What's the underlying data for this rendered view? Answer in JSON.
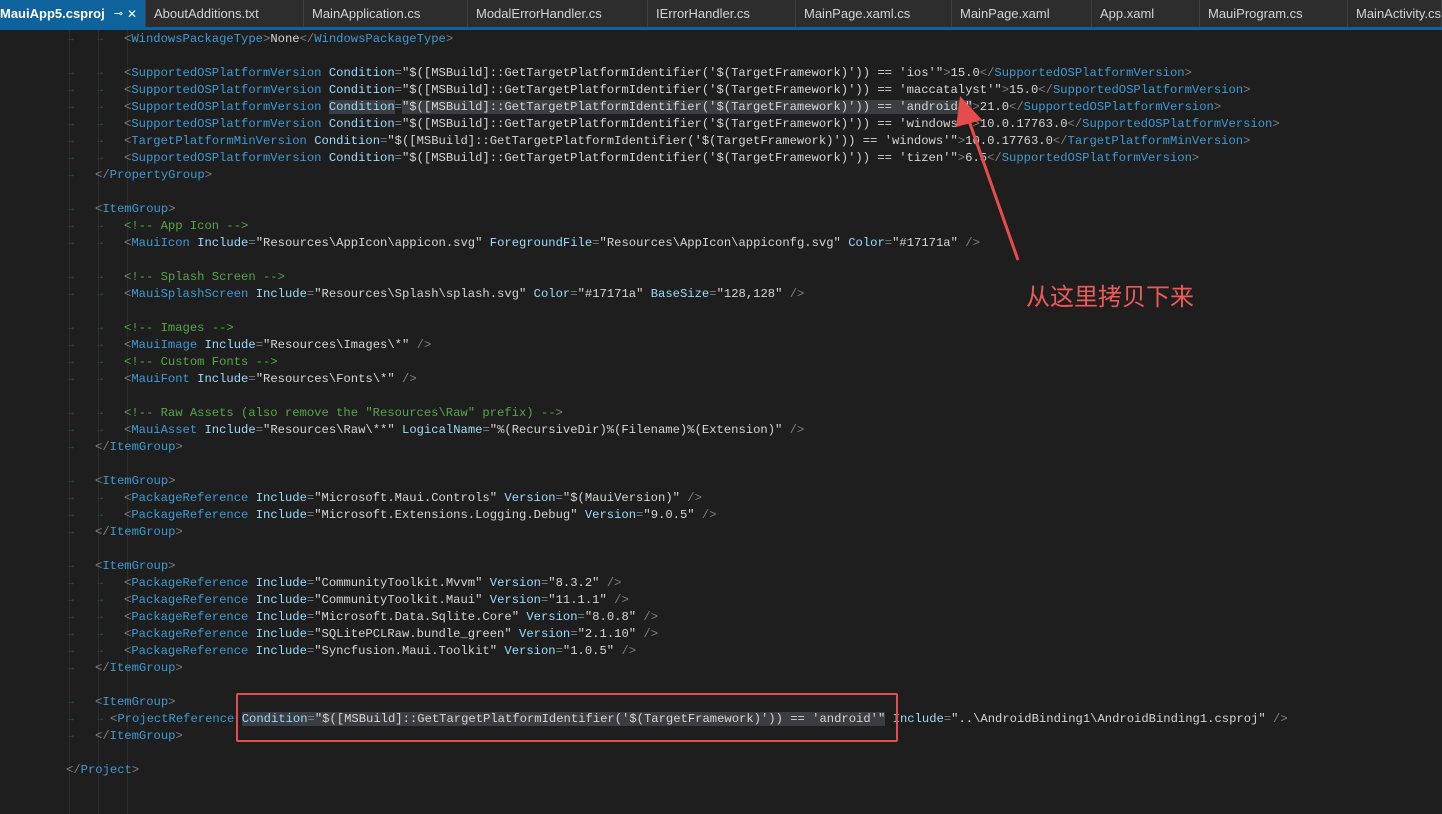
{
  "tabs": [
    {
      "label": "MauiApp5.csproj",
      "active": true,
      "pin_icon": "pin-icon",
      "close_icon": "close-icon"
    },
    {
      "label": "AboutAdditions.txt"
    },
    {
      "label": "MainApplication.cs"
    },
    {
      "label": "ModalErrorHandler.cs"
    },
    {
      "label": "IErrorHandler.cs"
    },
    {
      "label": "MainPage.xaml.cs"
    },
    {
      "label": "MainPage.xaml"
    },
    {
      "label": "App.xaml"
    },
    {
      "label": "MauiProgram.cs"
    },
    {
      "label": "MainActivity.cs"
    }
  ],
  "colors": {
    "tag": "#3f9bd4",
    "attribute": "#9cdcfe",
    "comment": "#57a64a",
    "annotation": "#ec5a5a",
    "tab_active": "#0e639c"
  },
  "annotation": {
    "text": "从这里拷贝下来",
    "arrow_icon": "red-arrow-icon"
  },
  "lines": [
    {
      "indent": 2,
      "tokens": [
        [
          "b",
          "<"
        ],
        [
          "t",
          "WindowsPackageType"
        ],
        [
          "b",
          ">"
        ],
        [
          "v",
          "None"
        ],
        [
          "b",
          "</"
        ],
        [
          "t",
          "WindowsPackageType"
        ],
        [
          "b",
          ">"
        ]
      ]
    },
    {
      "indent": 0,
      "tokens": []
    },
    {
      "indent": 2,
      "tokens": [
        [
          "b",
          "<"
        ],
        [
          "t",
          "SupportedOSPlatformVersion"
        ],
        [
          "p",
          " "
        ],
        [
          "a",
          "Condition"
        ],
        [
          "b",
          "="
        ],
        [
          "v",
          "\"$([MSBuild]::GetTargetPlatformIdentifier('$(TargetFramework)')) == 'ios'\""
        ],
        [
          "b",
          ">"
        ],
        [
          "v",
          "15.0"
        ],
        [
          "b",
          "</"
        ],
        [
          "t",
          "SupportedOSPlatformVersion"
        ],
        [
          "b",
          ">"
        ]
      ]
    },
    {
      "indent": 2,
      "tokens": [
        [
          "b",
          "<"
        ],
        [
          "t",
          "SupportedOSPlatformVersion"
        ],
        [
          "p",
          " "
        ],
        [
          "a",
          "Condition"
        ],
        [
          "b",
          "="
        ],
        [
          "v",
          "\"$([MSBuild]::GetTargetPlatformIdentifier('$(TargetFramework)')) == 'maccatalyst'\""
        ],
        [
          "b",
          ">"
        ],
        [
          "v",
          "15.0"
        ],
        [
          "b",
          "</"
        ],
        [
          "t",
          "SupportedOSPlatformVersion"
        ],
        [
          "b",
          ">"
        ]
      ]
    },
    {
      "indent": 2,
      "tokens": [
        [
          "b",
          "<"
        ],
        [
          "t",
          "SupportedOSPlatformVersion"
        ],
        [
          "p",
          " "
        ],
        [
          "ah",
          "Condition"
        ],
        [
          "b",
          "="
        ],
        [
          "vh",
          "\"$([MSBuild]::GetTargetPlatformIdentifier('$(TargetFramework)')) == 'android'\""
        ],
        [
          "b",
          ">"
        ],
        [
          "v",
          "21.0"
        ],
        [
          "b",
          "</"
        ],
        [
          "t",
          "SupportedOSPlatformVersion"
        ],
        [
          "b",
          ">"
        ]
      ]
    },
    {
      "indent": 2,
      "tokens": [
        [
          "b",
          "<"
        ],
        [
          "t",
          "SupportedOSPlatformVersion"
        ],
        [
          "p",
          " "
        ],
        [
          "a",
          "Condition"
        ],
        [
          "b",
          "="
        ],
        [
          "v",
          "\"$([MSBuild]::GetTargetPlatformIdentifier('$(TargetFramework)')) == 'windows'\""
        ],
        [
          "b",
          ">"
        ],
        [
          "v",
          "10.0.17763.0"
        ],
        [
          "b",
          "</"
        ],
        [
          "t",
          "SupportedOSPlatformVersion"
        ],
        [
          "b",
          ">"
        ]
      ]
    },
    {
      "indent": 2,
      "tokens": [
        [
          "b",
          "<"
        ],
        [
          "t",
          "TargetPlatformMinVersion"
        ],
        [
          "p",
          " "
        ],
        [
          "a",
          "Condition"
        ],
        [
          "b",
          "="
        ],
        [
          "v",
          "\"$([MSBuild]::GetTargetPlatformIdentifier('$(TargetFramework)')) == 'windows'\""
        ],
        [
          "b",
          ">"
        ],
        [
          "v",
          "10.0.17763.0"
        ],
        [
          "b",
          "</"
        ],
        [
          "t",
          "TargetPlatformMinVersion"
        ],
        [
          "b",
          ">"
        ]
      ]
    },
    {
      "indent": 2,
      "tokens": [
        [
          "b",
          "<"
        ],
        [
          "t",
          "SupportedOSPlatformVersion"
        ],
        [
          "p",
          " "
        ],
        [
          "a",
          "Condition"
        ],
        [
          "b",
          "="
        ],
        [
          "v",
          "\"$([MSBuild]::GetTargetPlatformIdentifier('$(TargetFramework)')) == 'tizen'\""
        ],
        [
          "b",
          ">"
        ],
        [
          "v",
          "6.5"
        ],
        [
          "b",
          "</"
        ],
        [
          "t",
          "SupportedOSPlatformVersion"
        ],
        [
          "b",
          ">"
        ]
      ]
    },
    {
      "indent": 1,
      "tokens": [
        [
          "b",
          "</"
        ],
        [
          "t",
          "PropertyGroup"
        ],
        [
          "b",
          ">"
        ]
      ]
    },
    {
      "indent": 0,
      "tokens": []
    },
    {
      "indent": 1,
      "tokens": [
        [
          "b",
          "<"
        ],
        [
          "t",
          "ItemGroup"
        ],
        [
          "b",
          ">"
        ]
      ]
    },
    {
      "indent": 2,
      "tokens": [
        [
          "c",
          "<!-- App Icon -->"
        ]
      ]
    },
    {
      "indent": 2,
      "tokens": [
        [
          "b",
          "<"
        ],
        [
          "t",
          "MauiIcon"
        ],
        [
          "p",
          " "
        ],
        [
          "a",
          "Include"
        ],
        [
          "b",
          "="
        ],
        [
          "v",
          "\"Resources\\AppIcon\\appicon.svg\""
        ],
        [
          "p",
          " "
        ],
        [
          "a",
          "ForegroundFile"
        ],
        [
          "b",
          "="
        ],
        [
          "v",
          "\"Resources\\AppIcon\\appiconfg.svg\""
        ],
        [
          "p",
          " "
        ],
        [
          "a",
          "Color"
        ],
        [
          "b",
          "="
        ],
        [
          "v",
          "\"#17171a\""
        ],
        [
          "p",
          " "
        ],
        [
          "b",
          "/>"
        ]
      ]
    },
    {
      "indent": 0,
      "tokens": []
    },
    {
      "indent": 2,
      "tokens": [
        [
          "c",
          "<!-- Splash Screen -->"
        ]
      ]
    },
    {
      "indent": 2,
      "tokens": [
        [
          "b",
          "<"
        ],
        [
          "t",
          "MauiSplashScreen"
        ],
        [
          "p",
          " "
        ],
        [
          "a",
          "Include"
        ],
        [
          "b",
          "="
        ],
        [
          "v",
          "\"Resources\\Splash\\splash.svg\""
        ],
        [
          "p",
          " "
        ],
        [
          "a",
          "Color"
        ],
        [
          "b",
          "="
        ],
        [
          "v",
          "\"#17171a\""
        ],
        [
          "p",
          " "
        ],
        [
          "a",
          "BaseSize"
        ],
        [
          "b",
          "="
        ],
        [
          "v",
          "\"128,128\""
        ],
        [
          "p",
          " "
        ],
        [
          "b",
          "/>"
        ]
      ]
    },
    {
      "indent": 0,
      "tokens": []
    },
    {
      "indent": 2,
      "tokens": [
        [
          "c",
          "<!-- Images -->"
        ]
      ]
    },
    {
      "indent": 2,
      "tokens": [
        [
          "b",
          "<"
        ],
        [
          "t",
          "MauiImage"
        ],
        [
          "p",
          " "
        ],
        [
          "a",
          "Include"
        ],
        [
          "b",
          "="
        ],
        [
          "v",
          "\"Resources\\Images\\*\""
        ],
        [
          "p",
          " "
        ],
        [
          "b",
          "/>"
        ]
      ]
    },
    {
      "indent": 2,
      "tokens": [
        [
          "c",
          "<!-- Custom Fonts -->"
        ]
      ]
    },
    {
      "indent": 2,
      "tokens": [
        [
          "b",
          "<"
        ],
        [
          "t",
          "MauiFont"
        ],
        [
          "p",
          " "
        ],
        [
          "a",
          "Include"
        ],
        [
          "b",
          "="
        ],
        [
          "v",
          "\"Resources\\Fonts\\*\""
        ],
        [
          "p",
          " "
        ],
        [
          "b",
          "/>"
        ]
      ]
    },
    {
      "indent": 0,
      "tokens": []
    },
    {
      "indent": 2,
      "tokens": [
        [
          "c",
          "<!-- Raw Assets (also remove the \"Resources\\Raw\" prefix) -->"
        ]
      ]
    },
    {
      "indent": 2,
      "tokens": [
        [
          "b",
          "<"
        ],
        [
          "t",
          "MauiAsset"
        ],
        [
          "p",
          " "
        ],
        [
          "a",
          "Include"
        ],
        [
          "b",
          "="
        ],
        [
          "v",
          "\"Resources\\Raw\\**\""
        ],
        [
          "p",
          " "
        ],
        [
          "a",
          "LogicalName"
        ],
        [
          "b",
          "="
        ],
        [
          "v",
          "\"%(RecursiveDir)%(Filename)%(Extension)\""
        ],
        [
          "p",
          " "
        ],
        [
          "b",
          "/>"
        ]
      ]
    },
    {
      "indent": 1,
      "tokens": [
        [
          "b",
          "</"
        ],
        [
          "t",
          "ItemGroup"
        ],
        [
          "b",
          ">"
        ]
      ]
    },
    {
      "indent": 0,
      "tokens": []
    },
    {
      "indent": 1,
      "tokens": [
        [
          "b",
          "<"
        ],
        [
          "t",
          "ItemGroup"
        ],
        [
          "b",
          ">"
        ]
      ]
    },
    {
      "indent": 2,
      "tokens": [
        [
          "b",
          "<"
        ],
        [
          "t",
          "PackageReference"
        ],
        [
          "p",
          " "
        ],
        [
          "a",
          "Include"
        ],
        [
          "b",
          "="
        ],
        [
          "v",
          "\"Microsoft.Maui.Controls\""
        ],
        [
          "p",
          " "
        ],
        [
          "a",
          "Version"
        ],
        [
          "b",
          "="
        ],
        [
          "v",
          "\"$(MauiVersion)\""
        ],
        [
          "p",
          " "
        ],
        [
          "b",
          "/>"
        ]
      ]
    },
    {
      "indent": 2,
      "tokens": [
        [
          "b",
          "<"
        ],
        [
          "t",
          "PackageReference"
        ],
        [
          "p",
          " "
        ],
        [
          "a",
          "Include"
        ],
        [
          "b",
          "="
        ],
        [
          "v",
          "\"Microsoft.Extensions.Logging.Debug\""
        ],
        [
          "p",
          " "
        ],
        [
          "a",
          "Version"
        ],
        [
          "b",
          "="
        ],
        [
          "v",
          "\"9.0.5\""
        ],
        [
          "p",
          " "
        ],
        [
          "b",
          "/>"
        ]
      ]
    },
    {
      "indent": 1,
      "tokens": [
        [
          "b",
          "</"
        ],
        [
          "t",
          "ItemGroup"
        ],
        [
          "b",
          ">"
        ]
      ]
    },
    {
      "indent": 0,
      "tokens": []
    },
    {
      "indent": 1,
      "tokens": [
        [
          "b",
          "<"
        ],
        [
          "t",
          "ItemGroup"
        ],
        [
          "b",
          ">"
        ]
      ]
    },
    {
      "indent": 2,
      "tokens": [
        [
          "b",
          "<"
        ],
        [
          "t",
          "PackageReference"
        ],
        [
          "p",
          " "
        ],
        [
          "a",
          "Include"
        ],
        [
          "b",
          "="
        ],
        [
          "v",
          "\"CommunityToolkit.Mvvm\""
        ],
        [
          "p",
          " "
        ],
        [
          "a",
          "Version"
        ],
        [
          "b",
          "="
        ],
        [
          "v",
          "\"8.3.2\""
        ],
        [
          "p",
          " "
        ],
        [
          "b",
          "/>"
        ]
      ]
    },
    {
      "indent": 2,
      "tokens": [
        [
          "b",
          "<"
        ],
        [
          "t",
          "PackageReference"
        ],
        [
          "p",
          " "
        ],
        [
          "a",
          "Include"
        ],
        [
          "b",
          "="
        ],
        [
          "v",
          "\"CommunityToolkit.Maui\""
        ],
        [
          "p",
          " "
        ],
        [
          "a",
          "Version"
        ],
        [
          "b",
          "="
        ],
        [
          "v",
          "\"11.1.1\""
        ],
        [
          "p",
          " "
        ],
        [
          "b",
          "/>"
        ]
      ]
    },
    {
      "indent": 2,
      "tokens": [
        [
          "b",
          "<"
        ],
        [
          "t",
          "PackageReference"
        ],
        [
          "p",
          " "
        ],
        [
          "a",
          "Include"
        ],
        [
          "b",
          "="
        ],
        [
          "v",
          "\"Microsoft.Data.Sqlite.Core\""
        ],
        [
          "p",
          " "
        ],
        [
          "a",
          "Version"
        ],
        [
          "b",
          "="
        ],
        [
          "v",
          "\"8.0.8\""
        ],
        [
          "p",
          " "
        ],
        [
          "b",
          "/>"
        ]
      ]
    },
    {
      "indent": 2,
      "tokens": [
        [
          "b",
          "<"
        ],
        [
          "t",
          "PackageReference"
        ],
        [
          "p",
          " "
        ],
        [
          "a",
          "Include"
        ],
        [
          "b",
          "="
        ],
        [
          "v",
          "\"SQLitePCLRaw.bundle_green\""
        ],
        [
          "p",
          " "
        ],
        [
          "a",
          "Version"
        ],
        [
          "b",
          "="
        ],
        [
          "v",
          "\"2.1.10\""
        ],
        [
          "p",
          " "
        ],
        [
          "b",
          "/>"
        ]
      ]
    },
    {
      "indent": 2,
      "tokens": [
        [
          "b",
          "<"
        ],
        [
          "t",
          "PackageReference"
        ],
        [
          "p",
          " "
        ],
        [
          "a",
          "Include"
        ],
        [
          "b",
          "="
        ],
        [
          "v",
          "\"Syncfusion.Maui.Toolkit\""
        ],
        [
          "p",
          " "
        ],
        [
          "a",
          "Version"
        ],
        [
          "b",
          "="
        ],
        [
          "v",
          "\"1.0.5\""
        ],
        [
          "p",
          " "
        ],
        [
          "b",
          "/>"
        ]
      ]
    },
    {
      "indent": 1,
      "tokens": [
        [
          "b",
          "</"
        ],
        [
          "t",
          "ItemGroup"
        ],
        [
          "b",
          ">"
        ]
      ]
    },
    {
      "indent": 0,
      "tokens": []
    },
    {
      "indent": 1,
      "tokens": [
        [
          "b",
          "<"
        ],
        [
          "t",
          "ItemGroup"
        ],
        [
          "b",
          ">"
        ]
      ]
    },
    {
      "indent": 2,
      "tokens": [
        [
          "b",
          "<"
        ],
        [
          "t",
          "ProjectReference"
        ],
        [
          "p",
          " "
        ],
        [
          "ah",
          "Condition"
        ],
        [
          "bh",
          "="
        ],
        [
          "vh",
          "\"$([MSBuild]::GetTargetPlatformIdentifier('$(TargetFramework)')) == 'android'\""
        ],
        [
          "p",
          " "
        ],
        [
          "a",
          "Include"
        ],
        [
          "b",
          "="
        ],
        [
          "v",
          "\"..\\AndroidBinding1\\AndroidBinding1.csproj\""
        ],
        [
          "p",
          " "
        ],
        [
          "b",
          "/>"
        ]
      ]
    },
    {
      "indent": 1,
      "tokens": [
        [
          "b",
          "</"
        ],
        [
          "t",
          "ItemGroup"
        ],
        [
          "b",
          ">"
        ]
      ]
    },
    {
      "indent": 0,
      "tokens": []
    },
    {
      "indent": 0,
      "tokens": [
        [
          "b",
          "</"
        ],
        [
          "t",
          "Project"
        ],
        [
          "b",
          ">"
        ]
      ]
    }
  ]
}
